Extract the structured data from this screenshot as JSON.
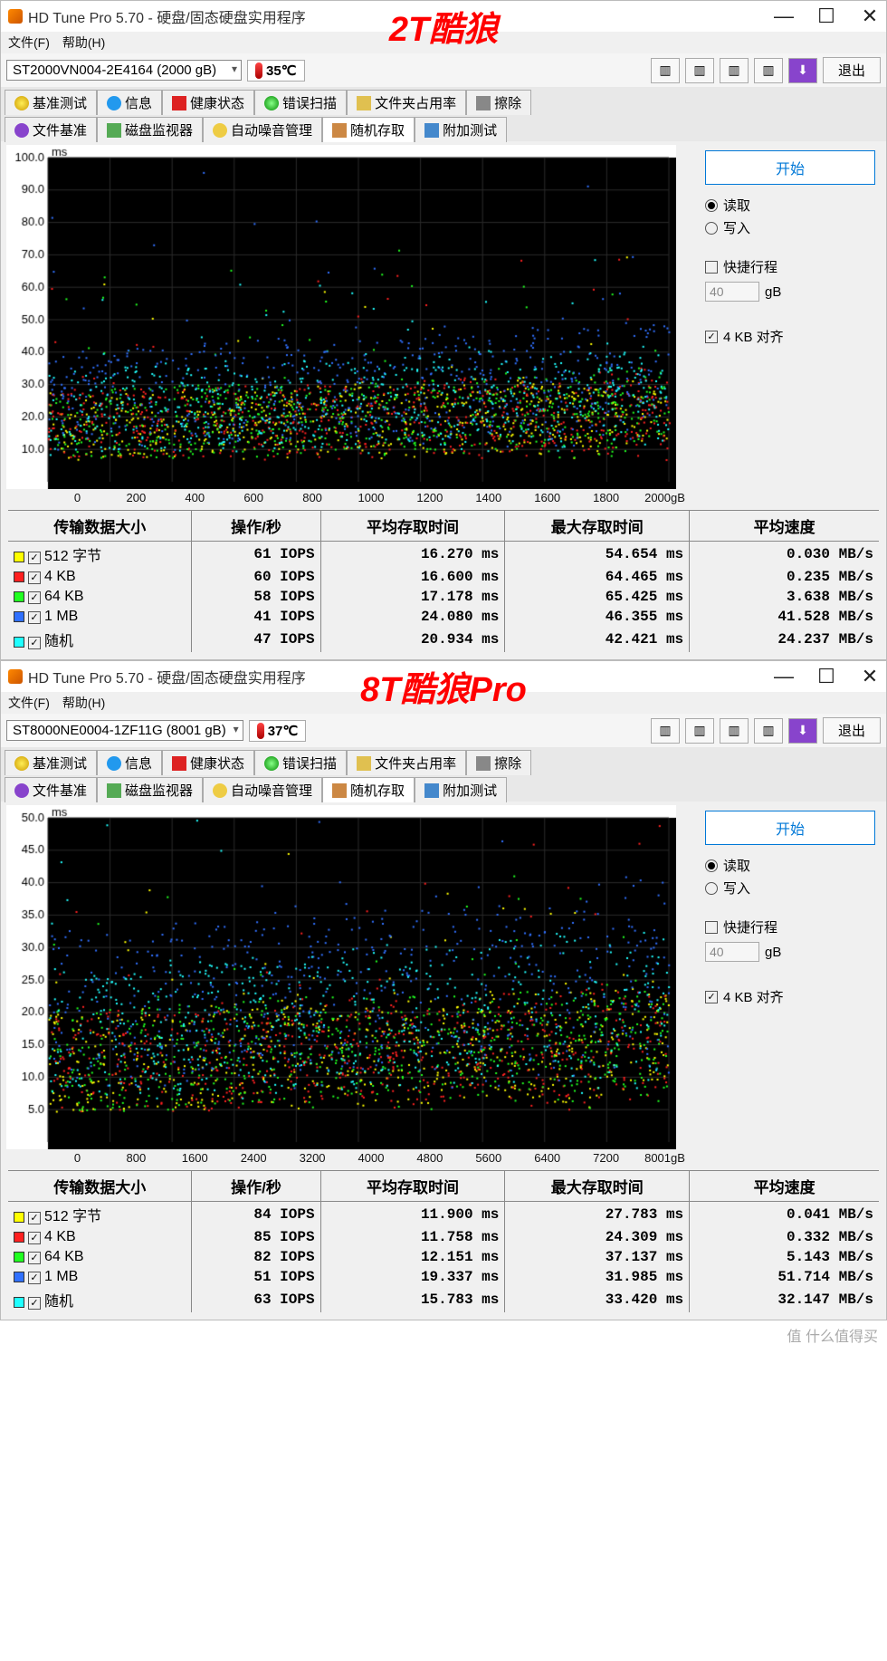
{
  "watermark": "值 什么值得买",
  "panels": [
    {
      "overlay": "2T酷狼",
      "title": "HD Tune Pro 5.70 - 硬盘/固态硬盘实用程序",
      "menu": {
        "file": "文件(F)",
        "help": "帮助(H)"
      },
      "drive": "ST2000VN004-2E4164 (2000 gB)",
      "temp": "35℃",
      "exit": "退出",
      "tabs_top": [
        {
          "icon": "bulb",
          "label": "基准测试"
        },
        {
          "icon": "info",
          "label": "信息"
        },
        {
          "icon": "health",
          "label": "健康状态"
        },
        {
          "icon": "scan",
          "label": "错误扫描"
        },
        {
          "icon": "folder",
          "label": "文件夹占用率"
        },
        {
          "icon": "erase",
          "label": "擦除"
        }
      ],
      "tabs_bottom": [
        {
          "icon": "purple",
          "label": "文件基准"
        },
        {
          "icon": "monitor",
          "label": "磁盘监视器"
        },
        {
          "icon": "sound",
          "label": "自动噪音管理"
        },
        {
          "icon": "random",
          "label": "随机存取",
          "active": true
        },
        {
          "icon": "extra",
          "label": "附加测试"
        }
      ],
      "side": {
        "start": "开始",
        "read": "读取",
        "write": "写入",
        "quick": "快捷行程",
        "quick_val": "40",
        "unit": "gB",
        "align": "4 KB 对齐"
      },
      "chart_data": {
        "type": "scatter",
        "xlabel": "gB",
        "ylabel": "ms",
        "xlim": [
          0,
          2000
        ],
        "ylim": [
          0,
          100
        ],
        "xticks": [
          0,
          200,
          400,
          600,
          800,
          1000,
          1200,
          1400,
          1600,
          1800,
          2000
        ],
        "yticks": [
          10,
          20,
          30,
          40,
          50,
          60,
          70,
          80,
          90,
          100
        ],
        "series": [
          {
            "name": "512 字节",
            "color": "#ffff00",
            "avg_ms": 16.27
          },
          {
            "name": "4 KB",
            "color": "#ff2020",
            "avg_ms": 16.6
          },
          {
            "name": "64 KB",
            "color": "#20ff20",
            "avg_ms": 17.178
          },
          {
            "name": "1 MB",
            "color": "#3070ff",
            "avg_ms": 24.08
          },
          {
            "name": "随机",
            "color": "#20ffff",
            "avg_ms": 20.934
          }
        ],
        "x_unit_label": "2000gB"
      },
      "results": {
        "headers": [
          "传输数据大小",
          "操作/秒",
          "平均存取时间",
          "最大存取时间",
          "平均速度"
        ],
        "rows": [
          {
            "color": "#ffff00",
            "label": "512 字节",
            "iops": "61 IOPS",
            "avg": "16.270 ms",
            "max": "54.654 ms",
            "speed": "0.030 MB/s"
          },
          {
            "color": "#ff2020",
            "label": "4 KB",
            "iops": "60 IOPS",
            "avg": "16.600 ms",
            "max": "64.465 ms",
            "speed": "0.235 MB/s"
          },
          {
            "color": "#20ff20",
            "label": "64 KB",
            "iops": "58 IOPS",
            "avg": "17.178 ms",
            "max": "65.425 ms",
            "speed": "3.638 MB/s"
          },
          {
            "color": "#3070ff",
            "label": "1 MB",
            "iops": "41 IOPS",
            "avg": "24.080 ms",
            "max": "46.355 ms",
            "speed": "41.528 MB/s"
          },
          {
            "color": "#20ffff",
            "label": "随机",
            "iops": "47 IOPS",
            "avg": "20.934 ms",
            "max": "42.421 ms",
            "speed": "24.237 MB/s"
          }
        ]
      }
    },
    {
      "overlay": "8T酷狼Pro",
      "title": "HD Tune Pro 5.70 - 硬盘/固态硬盘实用程序",
      "menu": {
        "file": "文件(F)",
        "help": "帮助(H)"
      },
      "drive": "ST8000NE0004-1ZF11G (8001 gB)",
      "temp": "37℃",
      "exit": "退出",
      "tabs_top": [
        {
          "icon": "bulb",
          "label": "基准测试"
        },
        {
          "icon": "info",
          "label": "信息"
        },
        {
          "icon": "health",
          "label": "健康状态"
        },
        {
          "icon": "scan",
          "label": "错误扫描"
        },
        {
          "icon": "folder",
          "label": "文件夹占用率"
        },
        {
          "icon": "erase",
          "label": "擦除"
        }
      ],
      "tabs_bottom": [
        {
          "icon": "purple",
          "label": "文件基准"
        },
        {
          "icon": "monitor",
          "label": "磁盘监视器"
        },
        {
          "icon": "sound",
          "label": "自动噪音管理"
        },
        {
          "icon": "random",
          "label": "随机存取",
          "active": true
        },
        {
          "icon": "extra",
          "label": "附加测试"
        }
      ],
      "side": {
        "start": "开始",
        "read": "读取",
        "write": "写入",
        "quick": "快捷行程",
        "quick_val": "40",
        "unit": "gB",
        "align": "4 KB 对齐"
      },
      "chart_data": {
        "type": "scatter",
        "xlabel": "gB",
        "ylabel": "ms",
        "xlim": [
          0,
          8001
        ],
        "ylim": [
          0,
          50
        ],
        "xticks": [
          0,
          800,
          1600,
          2400,
          3200,
          4000,
          4800,
          5600,
          6400,
          7200,
          8001
        ],
        "yticks": [
          5,
          10,
          15,
          20,
          25,
          30,
          35,
          40,
          45,
          50
        ],
        "series": [
          {
            "name": "512 字节",
            "color": "#ffff00",
            "avg_ms": 11.9
          },
          {
            "name": "4 KB",
            "color": "#ff2020",
            "avg_ms": 11.758
          },
          {
            "name": "64 KB",
            "color": "#20ff20",
            "avg_ms": 12.151
          },
          {
            "name": "1 MB",
            "color": "#3070ff",
            "avg_ms": 19.337
          },
          {
            "name": "随机",
            "color": "#20ffff",
            "avg_ms": 15.783
          }
        ],
        "x_unit_label": "8001gB"
      },
      "results": {
        "headers": [
          "传输数据大小",
          "操作/秒",
          "平均存取时间",
          "最大存取时间",
          "平均速度"
        ],
        "rows": [
          {
            "color": "#ffff00",
            "label": "512 字节",
            "iops": "84 IOPS",
            "avg": "11.900 ms",
            "max": "27.783 ms",
            "speed": "0.041 MB/s"
          },
          {
            "color": "#ff2020",
            "label": "4 KB",
            "iops": "85 IOPS",
            "avg": "11.758 ms",
            "max": "24.309 ms",
            "speed": "0.332 MB/s"
          },
          {
            "color": "#20ff20",
            "label": "64 KB",
            "iops": "82 IOPS",
            "avg": "12.151 ms",
            "max": "37.137 ms",
            "speed": "5.143 MB/s"
          },
          {
            "color": "#3070ff",
            "label": "1 MB",
            "iops": "51 IOPS",
            "avg": "19.337 ms",
            "max": "31.985 ms",
            "speed": "51.714 MB/s"
          },
          {
            "color": "#20ffff",
            "label": "随机",
            "iops": "63 IOPS",
            "avg": "15.783 ms",
            "max": "33.420 ms",
            "speed": "32.147 MB/s"
          }
        ]
      }
    }
  ]
}
